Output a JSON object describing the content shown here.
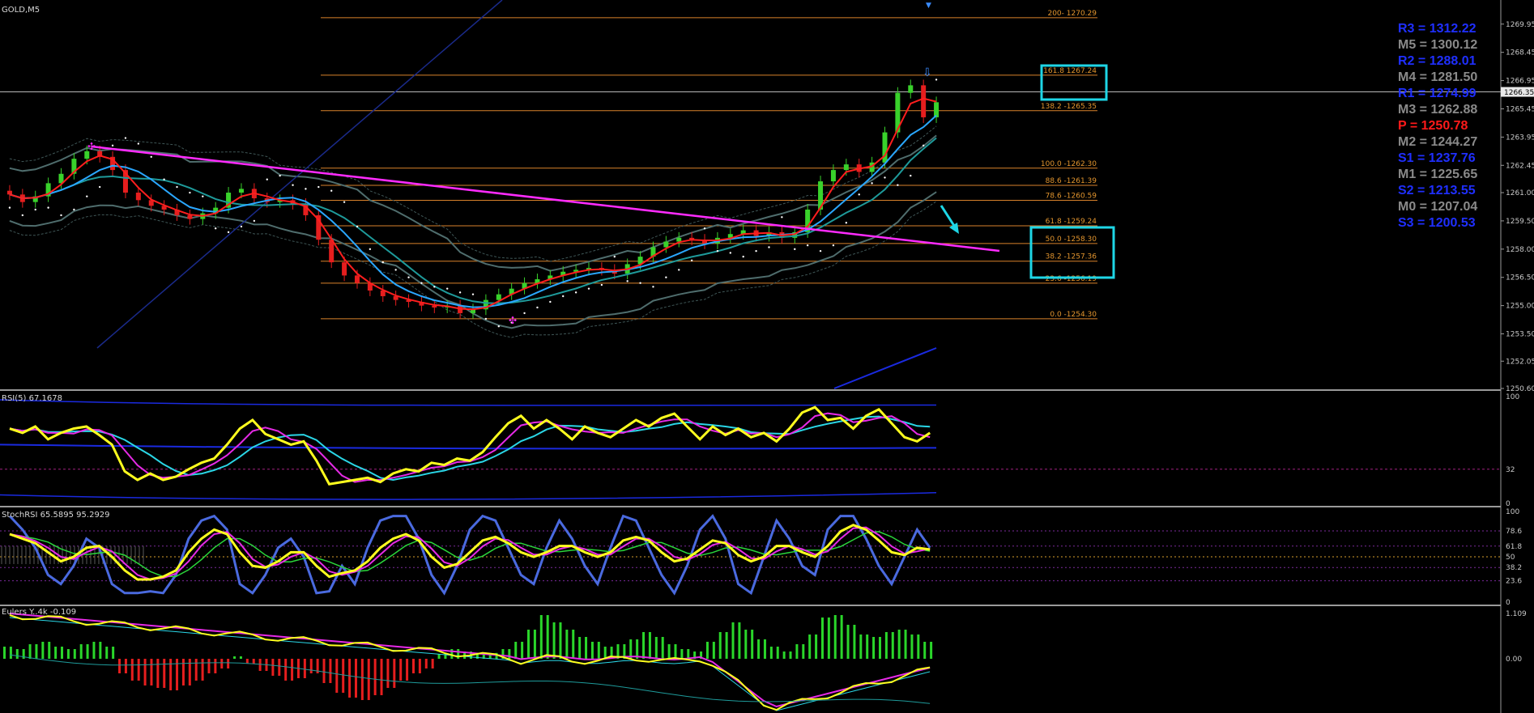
{
  "window": {
    "symbol_title": "GOLD,M5"
  },
  "pivots": [
    {
      "text": "R3 = 1312.22",
      "color": "#1f2fff"
    },
    {
      "text": "M5 = 1300.12",
      "color": "#8a8a8a"
    },
    {
      "text": "R2 = 1288.01",
      "color": "#1f2fff"
    },
    {
      "text": "M4 = 1281.50",
      "color": "#8a8a8a"
    },
    {
      "text": "R1 = 1274.99",
      "color": "#1f2fff"
    },
    {
      "text": "M3 = 1262.88",
      "color": "#8a8a8a"
    },
    {
      "text": "P   = 1250.78",
      "color": "#ff1a1a"
    },
    {
      "text": "M2 = 1244.27",
      "color": "#8a8a8a"
    },
    {
      "text": "S1 = 1237.76",
      "color": "#1f2fff"
    },
    {
      "text": "M1 = 1225.65",
      "color": "#8a8a8a"
    },
    {
      "text": "S2 = 1213.55",
      "color": "#1f2fff"
    },
    {
      "text": "M0 = 1207.04",
      "color": "#8a8a8a"
    },
    {
      "text": "S3 = 1200.53",
      "color": "#1f2fff"
    }
  ],
  "chart_data": [
    {
      "type": "line",
      "title": "GOLD,M5",
      "ylim": [
        1250.6,
        1270.8
      ],
      "price_scale_ticks": [
        "1269.95",
        "1268.45",
        "1266.95",
        "1265.45",
        "1263.95",
        "1262.45",
        "1261.00",
        "1259.50",
        "1258.00",
        "1256.50",
        "1255.00",
        "1253.50",
        "1252.05",
        "1250.60"
      ],
      "current_price": "1266.35",
      "fibonacci_levels": [
        {
          "label": "200- 1270.29",
          "value": 1270.29
        },
        {
          "label": "161.8 1267.24",
          "value": 1267.24
        },
        {
          "label": "138.2  -1265.35",
          "value": 1265.35
        },
        {
          "label": "100.0 -1262.30",
          "value": 1262.3
        },
        {
          "label": "88.6 -1261.39",
          "value": 1261.39
        },
        {
          "label": "78.6 -1260.59",
          "value": 1260.59
        },
        {
          "label": "61.8 -1259.24",
          "value": 1259.24
        },
        {
          "label": "50.0 -1258.30",
          "value": 1258.3
        },
        {
          "label": "38.2 -1257.36",
          "value": 1257.36
        },
        {
          "label": "23.6 -1256.19",
          "value": 1256.19
        },
        {
          "label": "0.0 -1254.30",
          "value": 1254.3
        }
      ],
      "close_series": [
        1260.9,
        1260.5,
        1260.8,
        1261.5,
        1262.0,
        1262.8,
        1263.2,
        1262.9,
        1262.2,
        1261.0,
        1260.6,
        1260.3,
        1260.1,
        1259.8,
        1259.6,
        1259.9,
        1260.2,
        1261.0,
        1261.2,
        1260.7,
        1260.5,
        1260.6,
        1260.4,
        1259.8,
        1258.5,
        1257.3,
        1256.6,
        1256.2,
        1255.8,
        1255.5,
        1255.3,
        1255.2,
        1255.0,
        1254.9,
        1255.0,
        1254.6,
        1254.8,
        1255.3,
        1255.6,
        1255.9,
        1256.2,
        1256.4,
        1256.6,
        1256.8,
        1256.9,
        1257.0,
        1256.9,
        1256.7,
        1257.2,
        1257.6,
        1258.1,
        1258.4,
        1258.6,
        1258.5,
        1258.3,
        1258.6,
        1258.8,
        1259.0,
        1258.7,
        1258.9,
        1258.6,
        1258.9,
        1260.1,
        1261.6,
        1262.2,
        1262.5,
        1262.1,
        1262.6,
        1264.2,
        1266.3,
        1266.7,
        1265.0,
        1265.8
      ]
    },
    {
      "type": "line",
      "title": "RSI(5) 67.1678",
      "ylim": [
        0,
        100
      ],
      "ticks": [
        "100",
        "32",
        "0"
      ],
      "series": [
        {
          "values": [
            70,
            66,
            72,
            60,
            66,
            70,
            72,
            64,
            55,
            30,
            22,
            28,
            22,
            25,
            32,
            38,
            42,
            55,
            70,
            78,
            65,
            60,
            55,
            58,
            40,
            18,
            20,
            22,
            24,
            20,
            28,
            32,
            30,
            38,
            36,
            42,
            40,
            48,
            62,
            75,
            82,
            70,
            78,
            70,
            60,
            72,
            66,
            62,
            70,
            78,
            72,
            80,
            84,
            72,
            60,
            72,
            64,
            70,
            62,
            66,
            58,
            70,
            85,
            90,
            78,
            80,
            70,
            82,
            88,
            75,
            62,
            58,
            66
          ]
        }
      ]
    },
    {
      "type": "line",
      "title": "StochRSI 65.5895 95.2929",
      "ylim": [
        0,
        100
      ],
      "ticks": [
        "100",
        "78.6",
        "61.8",
        "50",
        "38.2",
        "23.6",
        "0"
      ],
      "series": [
        {
          "values": [
            95,
            80,
            60,
            30,
            20,
            40,
            70,
            60,
            20,
            10,
            10,
            12,
            10,
            30,
            70,
            90,
            95,
            80,
            20,
            10,
            30,
            60,
            70,
            50,
            10,
            12,
            40,
            20,
            60,
            90,
            95,
            95,
            70,
            30,
            10,
            40,
            80,
            95,
            90,
            60,
            30,
            20,
            60,
            90,
            70,
            40,
            20,
            60,
            95,
            90,
            60,
            30,
            10,
            40,
            80,
            95,
            70,
            20,
            10,
            50,
            90,
            70,
            40,
            30,
            80,
            95,
            95,
            70,
            40,
            20,
            50,
            80,
            60
          ]
        },
        {
          "values": [
            75,
            70,
            65,
            55,
            45,
            50,
            60,
            62,
            50,
            35,
            25,
            25,
            28,
            35,
            55,
            70,
            80,
            75,
            55,
            40,
            38,
            45,
            55,
            55,
            40,
            28,
            32,
            35,
            45,
            60,
            70,
            75,
            68,
            50,
            38,
            42,
            55,
            68,
            72,
            65,
            55,
            50,
            55,
            62,
            62,
            55,
            50,
            55,
            68,
            72,
            68,
            55,
            45,
            48,
            58,
            68,
            65,
            52,
            45,
            50,
            62,
            62,
            55,
            50,
            62,
            78,
            85,
            80,
            68,
            55,
            52,
            60,
            58
          ]
        }
      ]
    },
    {
      "type": "bar",
      "title": "Eulers Y..4k -0.109",
      "ylim": [
        -1.109,
        1.109
      ],
      "ticks": [
        "1.109",
        "0.00"
      ],
      "series": [
        {
          "values": [
            0.25,
            0.2,
            0.3,
            0.35,
            0.25,
            0.2,
            0.3,
            0.35,
            0.25,
            -0.3,
            -0.45,
            -0.55,
            -0.6,
            -0.65,
            -0.55,
            -0.45,
            -0.3,
            -0.2,
            0.05,
            -0.1,
            -0.25,
            -0.35,
            -0.45,
            -0.4,
            -0.3,
            -0.5,
            -0.7,
            -0.8,
            -0.85,
            -0.75,
            -0.6,
            -0.45,
            -0.3,
            -0.2,
            0.1,
            0.2,
            0.15,
            0.1,
            0.12,
            0.2,
            0.35,
            0.6,
            0.9,
            0.75,
            0.6,
            0.45,
            0.35,
            0.25,
            0.3,
            0.4,
            0.55,
            0.45,
            0.3,
            0.2,
            0.15,
            0.35,
            0.55,
            0.75,
            0.6,
            0.4,
            0.25,
            0.15,
            0.3,
            0.5,
            0.85,
            0.9,
            0.7,
            0.5,
            0.45,
            0.55,
            0.6,
            0.5,
            0.35
          ]
        }
      ]
    }
  ]
}
